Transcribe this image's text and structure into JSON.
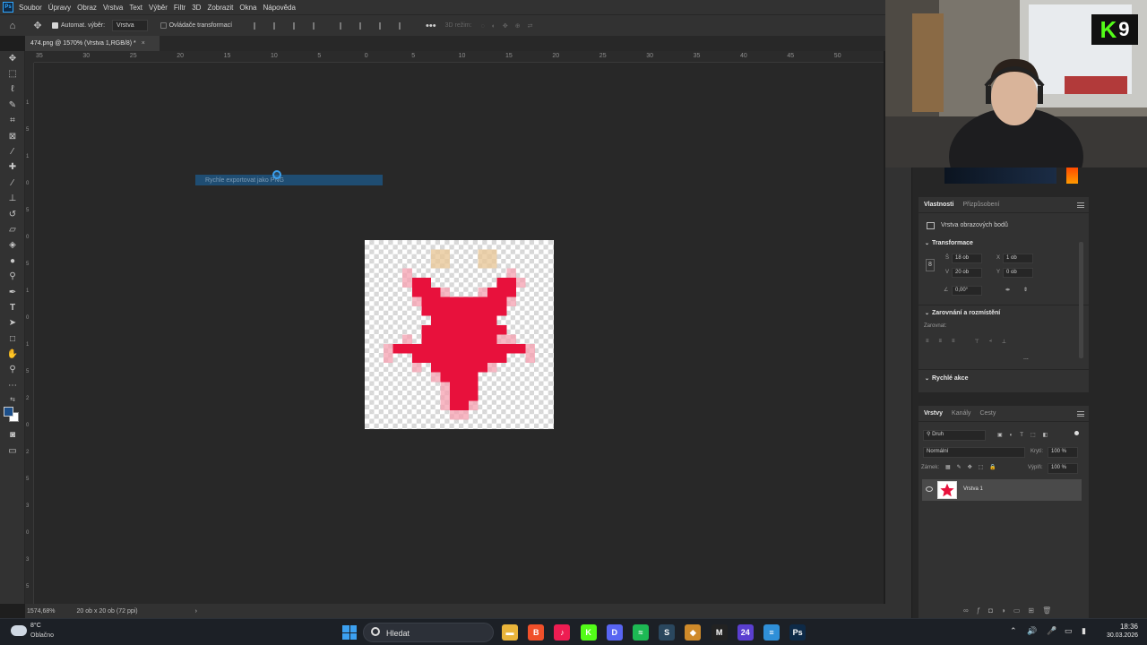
{
  "menu": {
    "app_icon": "Ps",
    "items": [
      "Soubor",
      "Úpravy",
      "Obraz",
      "Vrstva",
      "Text",
      "Výběr",
      "Filtr",
      "3D",
      "Zobrazit",
      "Okna",
      "Nápověda"
    ]
  },
  "options": {
    "auto_select_label": "Automat. výběr:",
    "auto_select_value": "Vrstva",
    "transform_controls_label": "Ovládače transformací",
    "mode_3d_label": "3D režim:",
    "more_icon": "ellipsis-icon"
  },
  "document": {
    "tab_title": "474.png @ 1570% (Vrstva 1,RGB/8) *",
    "close_glyph": "×"
  },
  "ruler": {
    "h_ticks": [
      "35",
      "30",
      "25",
      "20",
      "15",
      "10",
      "5",
      "0",
      "5",
      "10",
      "15",
      "20",
      "25",
      "30",
      "35",
      "40",
      "45",
      "50"
    ],
    "v_ticks": [
      "1",
      "5",
      "1",
      "0",
      "5",
      "0",
      "5",
      "1",
      "0",
      "1",
      "5",
      "2",
      "0",
      "2",
      "5",
      "3",
      "0",
      "3",
      "5"
    ]
  },
  "canvas": {
    "export_label": "Rychle exportovat jako PNG",
    "star_color": "#e8113c",
    "star_fade_color": "#f5a0b0",
    "dot_color": "#e9c89a"
  },
  "status": {
    "zoom": "1574,68%",
    "doc_size": "20 ob x 20 ob (72 ppi)",
    "arrow": "›"
  },
  "webcam": {
    "badge_letter": "K",
    "badge_number": "9"
  },
  "properties": {
    "tab_active": "Vlastnosti",
    "tab_other": "Přizpůsobení",
    "layer_type": "Vrstva obrazových bodů",
    "transform_header": "Transformace",
    "w_label": "Š",
    "w_value": "18 ob",
    "h_label": "V",
    "h_value": "20 ob",
    "x_label": "X",
    "x_value": "1 ob",
    "y_label": "Y",
    "y_value": "0 ob",
    "angle_value": "0,00°",
    "align_header": "Zarovnání a rozmístění",
    "align_label": "Zarovnat:",
    "quick_actions_header": "Rychlé akce",
    "more_glyph": "..."
  },
  "layers": {
    "tabs": [
      "Vrstvy",
      "Kanály",
      "Cesty"
    ],
    "filter_label": "Druh",
    "blend_mode": "Normální",
    "opacity_label": "Krytí:",
    "opacity_value": "100 %",
    "lock_label": "Zámek:",
    "fill_label": "Výplň:",
    "fill_value": "100 %",
    "layer_name": "Vrstva 1"
  },
  "taskbar": {
    "temperature": "8°C",
    "weather": "Oblačno",
    "search_placeholder": "Hledat",
    "apps": [
      {
        "name": "file-explorer-icon",
        "color": "#e9b43a",
        "glyph": "▬"
      },
      {
        "name": "brave-icon",
        "color": "#f0502a",
        "glyph": "B"
      },
      {
        "name": "tiktok-icon",
        "color": "#ee1d52",
        "glyph": "♪"
      },
      {
        "name": "kick-icon",
        "color": "#53fc18",
        "glyph": "K"
      },
      {
        "name": "discord-icon",
        "color": "#5865f2",
        "glyph": "D"
      },
      {
        "name": "spotify-icon",
        "color": "#1db954",
        "glyph": "≈"
      },
      {
        "name": "steam-icon",
        "color": "#2a475e",
        "glyph": "S"
      },
      {
        "name": "app-icon",
        "color": "#cf8a2a",
        "glyph": "◆"
      },
      {
        "name": "capcut-icon",
        "color": "#222222",
        "glyph": "M"
      },
      {
        "name": "app-24-icon",
        "color": "#5a3fd0",
        "glyph": "24"
      },
      {
        "name": "notes-icon",
        "color": "#2f8fd8",
        "glyph": "≡"
      },
      {
        "name": "photoshop-icon",
        "color": "#0e2a47",
        "glyph": "Ps"
      }
    ],
    "time": "18:36",
    "date": "30.03.2026"
  }
}
